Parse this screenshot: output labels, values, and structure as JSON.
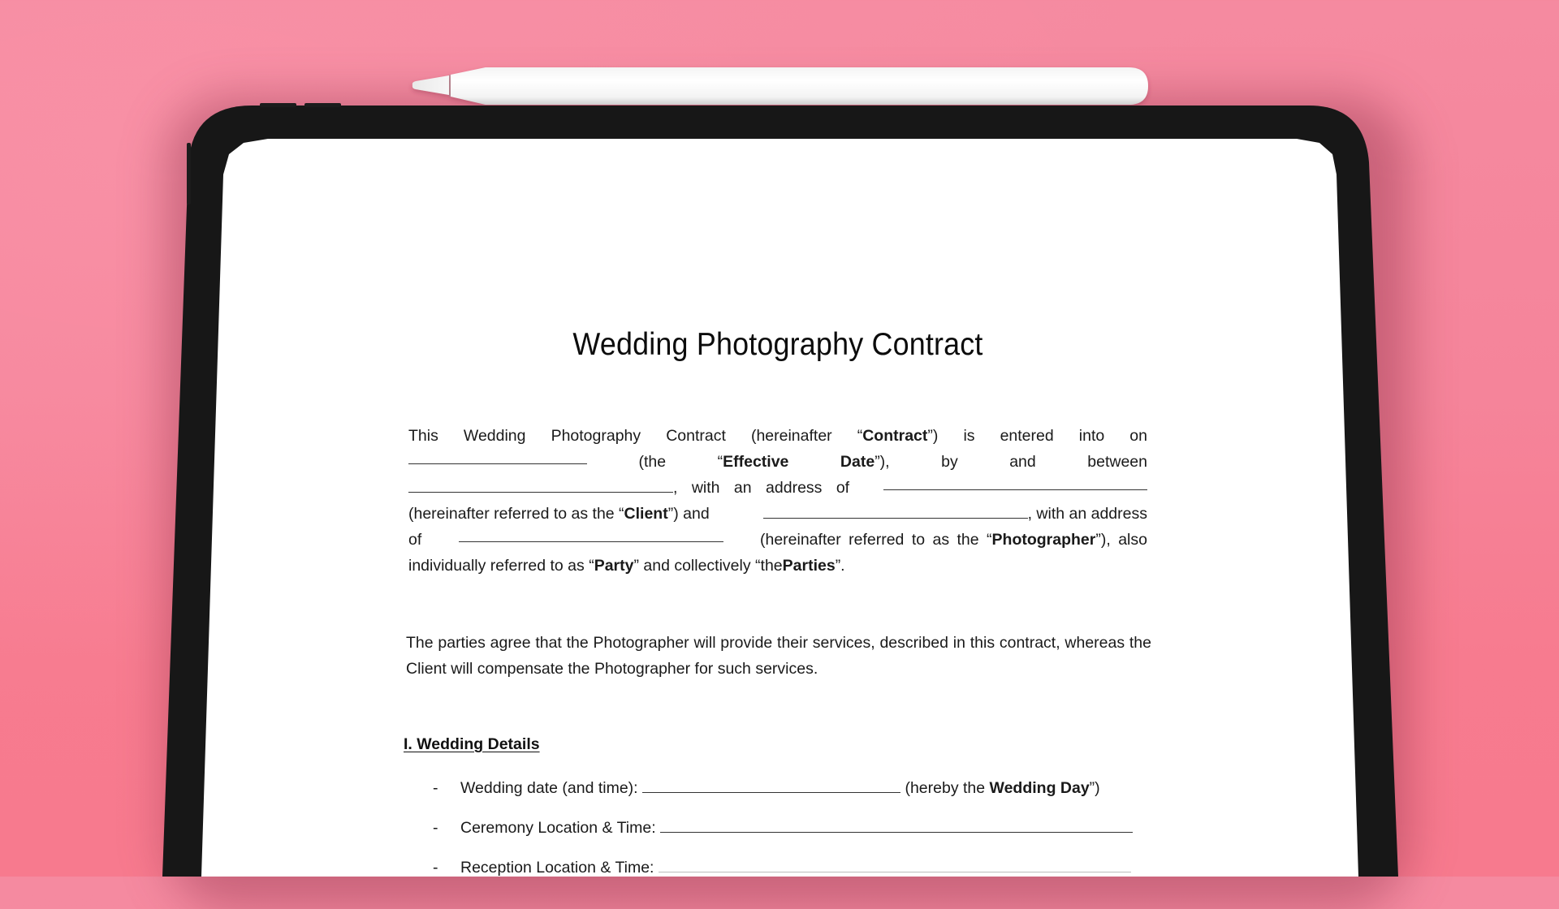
{
  "scene": {
    "background_color": "#f5849a",
    "device": "tablet",
    "device_frame_color": "#171717",
    "accessory": "stylus-pencil"
  },
  "document": {
    "title": "Wedding Photography Contract",
    "intro_lines": [
      {
        "parts": [
          {
            "text": "This",
            "bold": false
          },
          {
            "text": "Wedding",
            "bold": false
          },
          {
            "text": "Photography",
            "bold": false
          },
          {
            "text": "Contract",
            "bold": false
          },
          {
            "text": "(hereinafter",
            "bold": false
          },
          {
            "text": "“Contract”)",
            "bold": false,
            "bold_word": "Contract"
          },
          {
            "text": "is",
            "bold": false
          },
          {
            "text": "entered",
            "bold": false
          },
          {
            "text": "into",
            "bold": false
          },
          {
            "text": "on",
            "bold": false
          }
        ]
      },
      {
        "parts": [
          {
            "text": "",
            "blank": true
          },
          {
            "text": "(the",
            "bold": false
          },
          {
            "text": "“Effective",
            "bold": false,
            "bold_word": "Effective"
          },
          {
            "text": "Date”),",
            "bold": false,
            "bold_word": "Date"
          },
          {
            "text": "by",
            "bold": false
          },
          {
            "text": "and",
            "bold": false
          },
          {
            "text": "between",
            "bold": false
          }
        ]
      }
    ],
    "intro_text": {
      "l1": [
        "This",
        "Wedding",
        "Photography",
        "Contract",
        "(hereinafter",
        "is",
        "entered",
        "into",
        "on"
      ],
      "l1_bold": "Contract",
      "l2_the": "(the",
      "l2_bold1": "Effective",
      "l2_bold2": "Date",
      "l2_rest": [
        "by",
        "and",
        "between"
      ],
      "l3_mid": ", with an address of",
      "l4_pre": "(hereinafter referred to as the “",
      "l4_bold": "Client",
      "l4_post": "”) and",
      "l4_end": ", with an address",
      "l5_pre": "of",
      "l5_mid": "(hereinafter referred to as the “",
      "l5_bold": "Photographer",
      "l5_post": "”), also",
      "l6_pre": "individually referred to as “",
      "l6_bold1": "Party",
      "l6_mid": "” and collectively “the ",
      "l6_bold2": "Parties",
      "l6_post": "”."
    },
    "agreement_paragraph": "The parties agree that the Photographer will provide their services, described in this contract, whereas the Client will compensate the Photographer for such services.",
    "section": {
      "heading": "I. Wedding Details",
      "items": [
        {
          "bullet": "-",
          "label": "Wedding date (and time):",
          "suffix_pre": "(hereby the ",
          "suffix_bold": "Wedding Day",
          "suffix_post": "”)"
        },
        {
          "bullet": "-",
          "label": "Ceremony Location & Time:"
        },
        {
          "bullet": "-",
          "label": "Reception Location & Time:"
        }
      ]
    }
  }
}
